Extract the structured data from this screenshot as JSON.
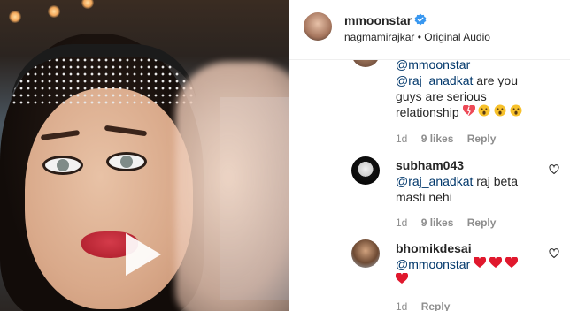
{
  "post": {
    "username": "mmoonstar",
    "subtitle": "nagmamirajkar • Original Audio",
    "verified": true
  },
  "colors": {
    "mention": "#00376b",
    "meta": "#8e8e8e",
    "verified": "#3897f0",
    "heart": "#ed4956"
  },
  "comments": [
    {
      "user": "",
      "lines": [
        "@mmoonstar",
        "@raj_anadkat are you",
        "guys are serious",
        "relationship"
      ],
      "emojis": [
        "broken-heart",
        "astonished-face",
        "astonished-face",
        "astonished-face"
      ],
      "time": "1d",
      "likes": "9 likes",
      "reply": "Reply"
    },
    {
      "user": "subham043",
      "mention": "@raj_anadkat",
      "text": "raj beta masti nehi",
      "time": "1d",
      "likes": "9 likes",
      "reply": "Reply"
    },
    {
      "user": "bhomikdesai",
      "mention": "@mmoonstar",
      "emojis": [
        "red-heart",
        "red-heart",
        "red-heart",
        "red-heart"
      ],
      "time": "1d",
      "reply": "Reply"
    }
  ]
}
